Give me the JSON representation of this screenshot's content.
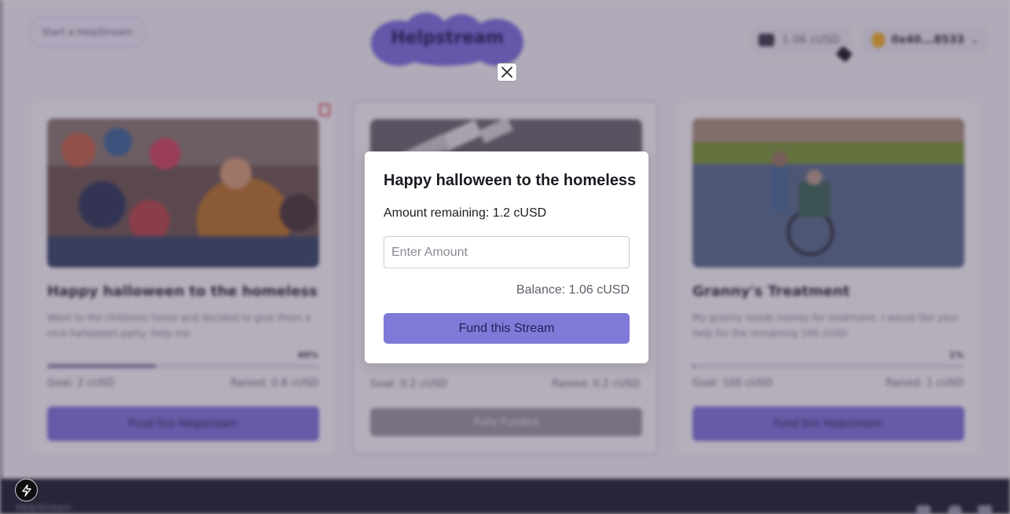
{
  "header": {
    "start_button_label": "Start a HelpStream",
    "logo_text": "Helpstream",
    "wallet_balance": "1.06 cUSD",
    "account_address": "0x40...8533"
  },
  "cards": [
    {
      "title": "Happy halloween to the homeless",
      "description": "Went to the childrens home and decided to give them a nice halloween party. Help me",
      "progress_percent": 40,
      "progress_label": "40%",
      "goal": "Goal: 2 cUSD",
      "raised": "Raised: 0.8 cUSD",
      "button_label": "Fund this Helpstream"
    },
    {
      "title": "",
      "description": "",
      "progress_percent": 100,
      "progress_label": "",
      "goal": "Goal: 0.2 cUSD",
      "raised": "Raised: 0.2 cUSD",
      "button_label": "Fully Funded"
    },
    {
      "title": "Granny's Treatment",
      "description": "My granny needs money for treatment. I would like your help for the remaining 100 cUSD",
      "progress_percent": 1,
      "progress_label": "1%",
      "goal": "Goal: 100 cUSD",
      "raised": "Raised: 1 cUSD",
      "button_label": "Fund this Helpstream"
    }
  ],
  "footer": {
    "brand": "HelpStream"
  },
  "modal": {
    "title": "Happy halloween to the homeless",
    "amount_remaining": "Amount remaining: 1.2 cUSD",
    "amount_placeholder": "Enter Amount",
    "amount_value": "",
    "balance": "Balance: 1.06 cUSD",
    "fund_button_label": "Fund this Stream"
  },
  "colors": {
    "accent": "#7f79d8",
    "overlay": "#3a2a48",
    "footer": "#1f2330"
  },
  "icons": {
    "close": "close-icon",
    "wallet": "wallet-icon",
    "trash": "trash-icon",
    "nextjs": "lightning-icon"
  }
}
